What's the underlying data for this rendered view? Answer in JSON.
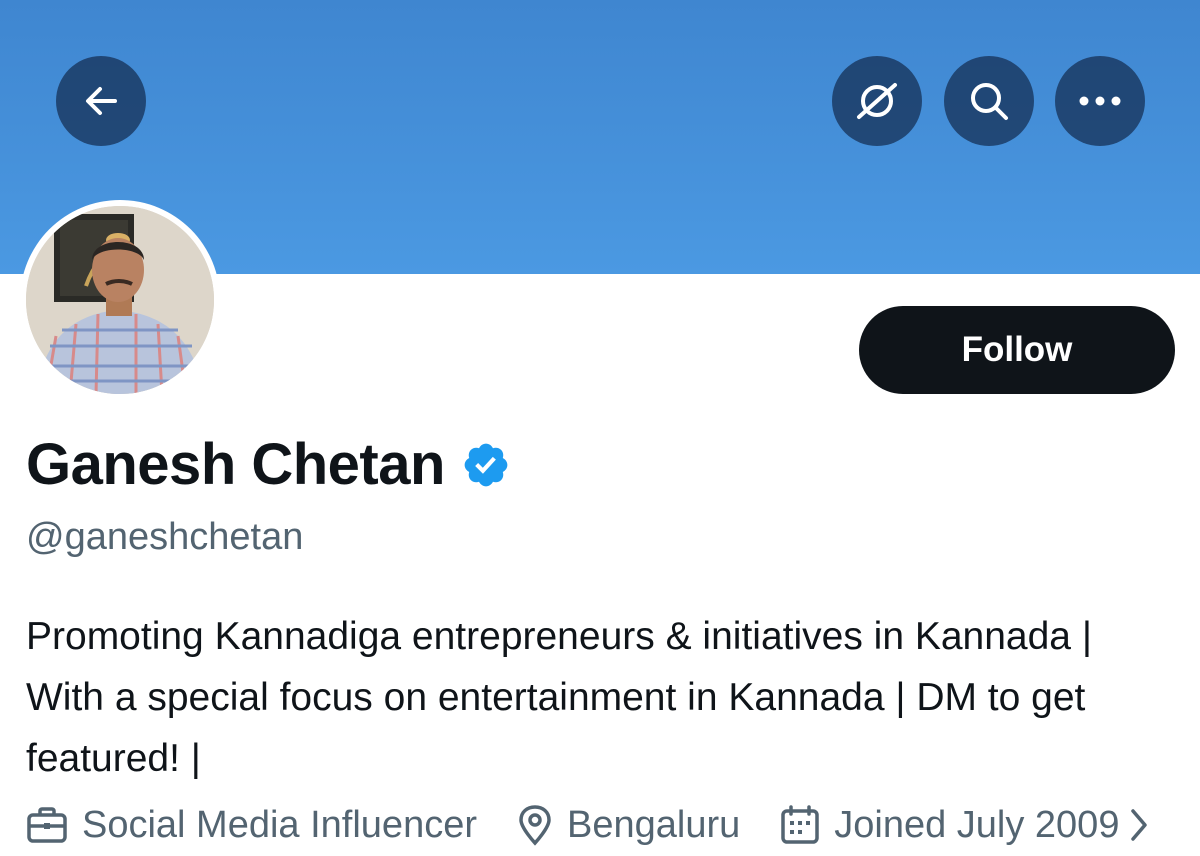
{
  "header": {
    "back_icon": "arrow-left-icon",
    "grok_icon": "grok-icon",
    "search_icon": "search-icon",
    "more_icon": "more-dots-icon",
    "banner_color": "#4a96e0"
  },
  "profile": {
    "display_name": "Ganesh Chetan",
    "verified_icon": "verified-badge-icon",
    "verified_color": "#1d9bf0",
    "handle": "@ganeshchetan",
    "follow_label": "Follow",
    "bio": "Promoting Kannadiga entrepreneurs & initiatives in Kannada | With a special focus on entertainment in Kannada | DM to get featured! |"
  },
  "meta": {
    "category": "Social Media Influencer",
    "location": "Bengaluru",
    "joined": "Joined July 2009"
  }
}
